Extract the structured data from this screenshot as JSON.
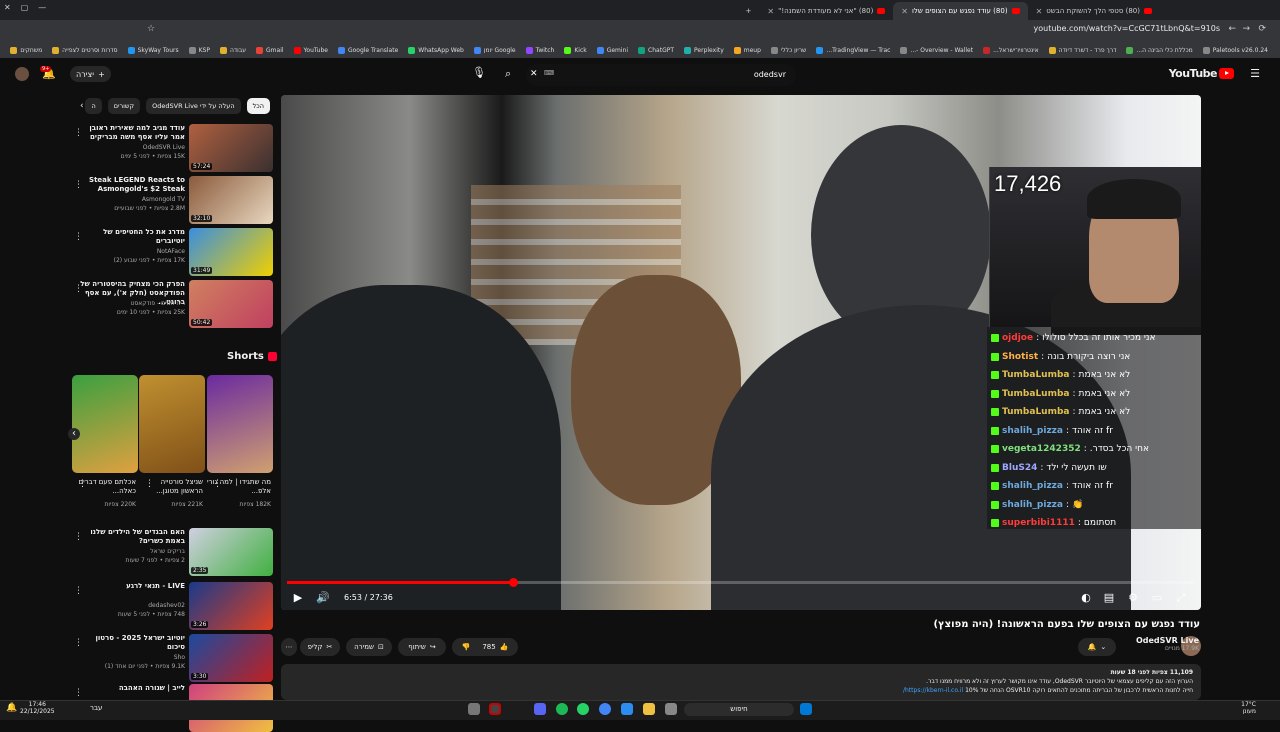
{
  "browser": {
    "tabs": [
      {
        "label": "(80) סטפי הלך להשוקת הבשט"
      },
      {
        "label": "(80) עודד נפגש עם הצופים שלו",
        "active": true
      },
      {
        "label": "(80) \"אני לא מעודדת השמנה!\""
      }
    ],
    "url": "youtube.com/watch?v=CcGC71tLbnQ&t=910s",
    "bookmarks": [
      {
        "label": "Paletools v26.0.24",
        "color": "#888888"
      },
      {
        "label": "מכללת כלי הבינה ה...",
        "color": "#4caf50"
      },
      {
        "label": "דרך פרד - דשרד דיודה",
        "color": "#e0b030"
      },
      {
        "label": "אינטרוויו־ישראל...",
        "color": "#c62828"
      },
      {
        "label": "Overview - Wallet -...",
        "color": "#888888"
      },
      {
        "label": "TradingView — Trac...",
        "color": "#2196f3"
      },
      {
        "label": "שריון כללי",
        "color": "#888888"
      },
      {
        "label": "meup",
        "color": "#f5a623"
      },
      {
        "label": "Perplexity",
        "color": "#20b2aa"
      },
      {
        "label": "ChatGPT",
        "color": "#10a37f"
      },
      {
        "label": "Gemini",
        "color": "#4285f4"
      },
      {
        "label": "Kick",
        "color": "#53fc18"
      },
      {
        "label": "Twitch",
        "color": "#9146ff"
      },
      {
        "label": "Google יומן",
        "color": "#4285f4"
      },
      {
        "label": "WhatsApp Web",
        "color": "#25d366"
      },
      {
        "label": "Google Translate",
        "color": "#4285f4"
      },
      {
        "label": "YouTube",
        "color": "#ff0000"
      },
      {
        "label": "Gmail",
        "color": "#ea4335"
      },
      {
        "label": "עבודה",
        "color": "#e0b030"
      },
      {
        "label": "KSP",
        "color": "#888888"
      },
      {
        "label": "SkyWay Tours",
        "color": "#2196f3"
      },
      {
        "label": "סדרות וסרטים לצפייה",
        "color": "#e0b030"
      },
      {
        "label": "משחקים",
        "color": "#e0b030"
      }
    ]
  },
  "masthead": {
    "logo": "YouTube",
    "search_value": "odedsvr",
    "create_label": "יצירה",
    "notif_count": "9+"
  },
  "chips": [
    {
      "label": "הכל",
      "selected": true
    },
    {
      "label": "העלה על ידי OdedSVR Live"
    },
    {
      "label": "קשורים"
    },
    {
      "label": "ה"
    }
  ],
  "recommendations": [
    {
      "title": "עודד מגיב למה שאירית ראובן אמר עליו אסף משה מבריקים",
      "channel": "OdedSVR Live",
      "meta": "15K צפיות • לפני 5 ימים",
      "duration": "57:24",
      "c1": "#b06040",
      "c2": "#3a3030"
    },
    {
      "title": "Steak LEGEND Reacts to Asmongold's $2 Steak",
      "channel": "Asmongold TV",
      "meta": "2.8M צפיות • לפני שבועיים",
      "duration": "32:10",
      "c1": "#8b5a3c",
      "c2": "#e8d8c0"
    },
    {
      "title": "מדרג את כל החטיפים של יוטיוברים",
      "channel": "NotAFace",
      "meta": "17K צפיות • לפני שבוע (2)",
      "duration": "31:49",
      "c1": "#3a8ee0",
      "c2": "#f0d000"
    },
    {
      "title": "הפרק הכי מצחיק בהיסטוריה של הפודקאסט (חלק א'), עם אסף ברונט...",
      "channel": "ריח חמים - פודקאסט",
      "meta": "25K צפיות • לפני 10 ימים",
      "duration": "50:42",
      "c1": "#d08060",
      "c2": "#c04060"
    },
    {
      "title": "האם הבגדים של הילדים שלנו באמת כשרים?",
      "channel": "בריקים שראל",
      "meta": "2 צפיות • לפני 7 שעות",
      "duration": "2:35",
      "c1": "#d0d0e0",
      "c2": "#40b040"
    },
    {
      "title": "LIVE - תנאי לרגע",
      "channel": "dedashev02",
      "meta": "748 צפיות • לפני 5 שעות",
      "duration": "3:26",
      "c1": "#1a3a8a",
      "c2": "#e04020"
    },
    {
      "title": "יוטיוב ישראל 2025 - סרטון סיכום",
      "channel": "Sho",
      "meta": "9.1K צפיות • לפני יום אחד (1)",
      "duration": "3:30",
      "c1": "#1a4aa0",
      "c2": "#c02020"
    },
    {
      "title": "לייב | שגורה האהבה",
      "channel": "",
      "meta": "",
      "duration": "",
      "c1": "#d04080",
      "c2": "#f0c040"
    }
  ],
  "shorts": {
    "title": "Shorts",
    "items": [
      {
        "caption": "מה שתגידו | למה גורי אלפ...",
        "views": "182K צפיות",
        "c1": "#6a2aa0",
        "c2": "#d0a070"
      },
      {
        "caption": "שניצל סורטייה הראשון מטוגן...",
        "views": "221K צפיות",
        "c1": "#c09030",
        "c2": "#805018"
      },
      {
        "caption": "אכלתם פעם דברים כאלה...",
        "views": "220K צפיות",
        "c1": "#3aa040",
        "c2": "#e0a040"
      }
    ]
  },
  "player": {
    "current_time": "6:53",
    "duration": "27:36",
    "progress_fraction": 0.249,
    "stream_viewers": "17,426"
  },
  "chat": [
    {
      "user": "ojdjoe",
      "message": "אני מכיר אותו זה בכלל סולולו",
      "color": "#ff3b3b"
    },
    {
      "user": "Shotist",
      "message": "אני רוצה ביקורת בונה",
      "color": "#ffb347"
    },
    {
      "user": "TumbaLumba",
      "message": "לא אני באמת",
      "color": "#e0c050"
    },
    {
      "user": "TumbaLumba",
      "message": "לא אני באמת",
      "color": "#e0c050"
    },
    {
      "user": "TumbaLumba",
      "message": "לא אני באמת",
      "color": "#e0c050"
    },
    {
      "user": "shalih_pizza",
      "message": "fr זה אוהד",
      "color": "#6fa8dc"
    },
    {
      "user": "vegeta1242352",
      "message": "אחי הכל בסדר.",
      "color": "#7ee07e"
    },
    {
      "user": "BluS24",
      "message": "שו תעשה לי ילד",
      "color": "#9fa8ff"
    },
    {
      "user": "shalih_pizza",
      "message": "fr זה אוהד",
      "color": "#6fa8dc"
    },
    {
      "user": "shalih_pizza",
      "message": "👏",
      "color": "#6fa8dc"
    },
    {
      "user": "superbibi1111",
      "message": "תסתומם",
      "color": "#ff3b3b"
    }
  ],
  "video": {
    "title": "עודד נפגש עם הצופים שלו בפעם הראשונה! (היה מפוצץ)",
    "channel_name": "OdedSVR Live",
    "subscribers": "17.9K מנויים",
    "likes": "785",
    "share_label": "שיתוף",
    "save_label": "שמירה",
    "clip_label": "קליפ",
    "views_meta": "11,109 צפיות  לפני 18 שעות",
    "description": "הערוץ הזה עם קליפים עצמאי של היוטיובר OdedSVR, עודד אינו מקושר לערוץ זה ולא מרוויח ממנו דבר.",
    "description2": "חייה לחנות הראשית לרכבון של הבריתה מתוכנים להתאים רוקה OSVR10 הנחה של 10%",
    "link": "https://kbern-il.co.il/"
  },
  "taskbar": {
    "time": "17:46",
    "date": "22/12/2025",
    "search_label": "חיפוש",
    "weather_temp": "17°C",
    "weather_desc": "מעונן",
    "lang": "עבר"
  }
}
